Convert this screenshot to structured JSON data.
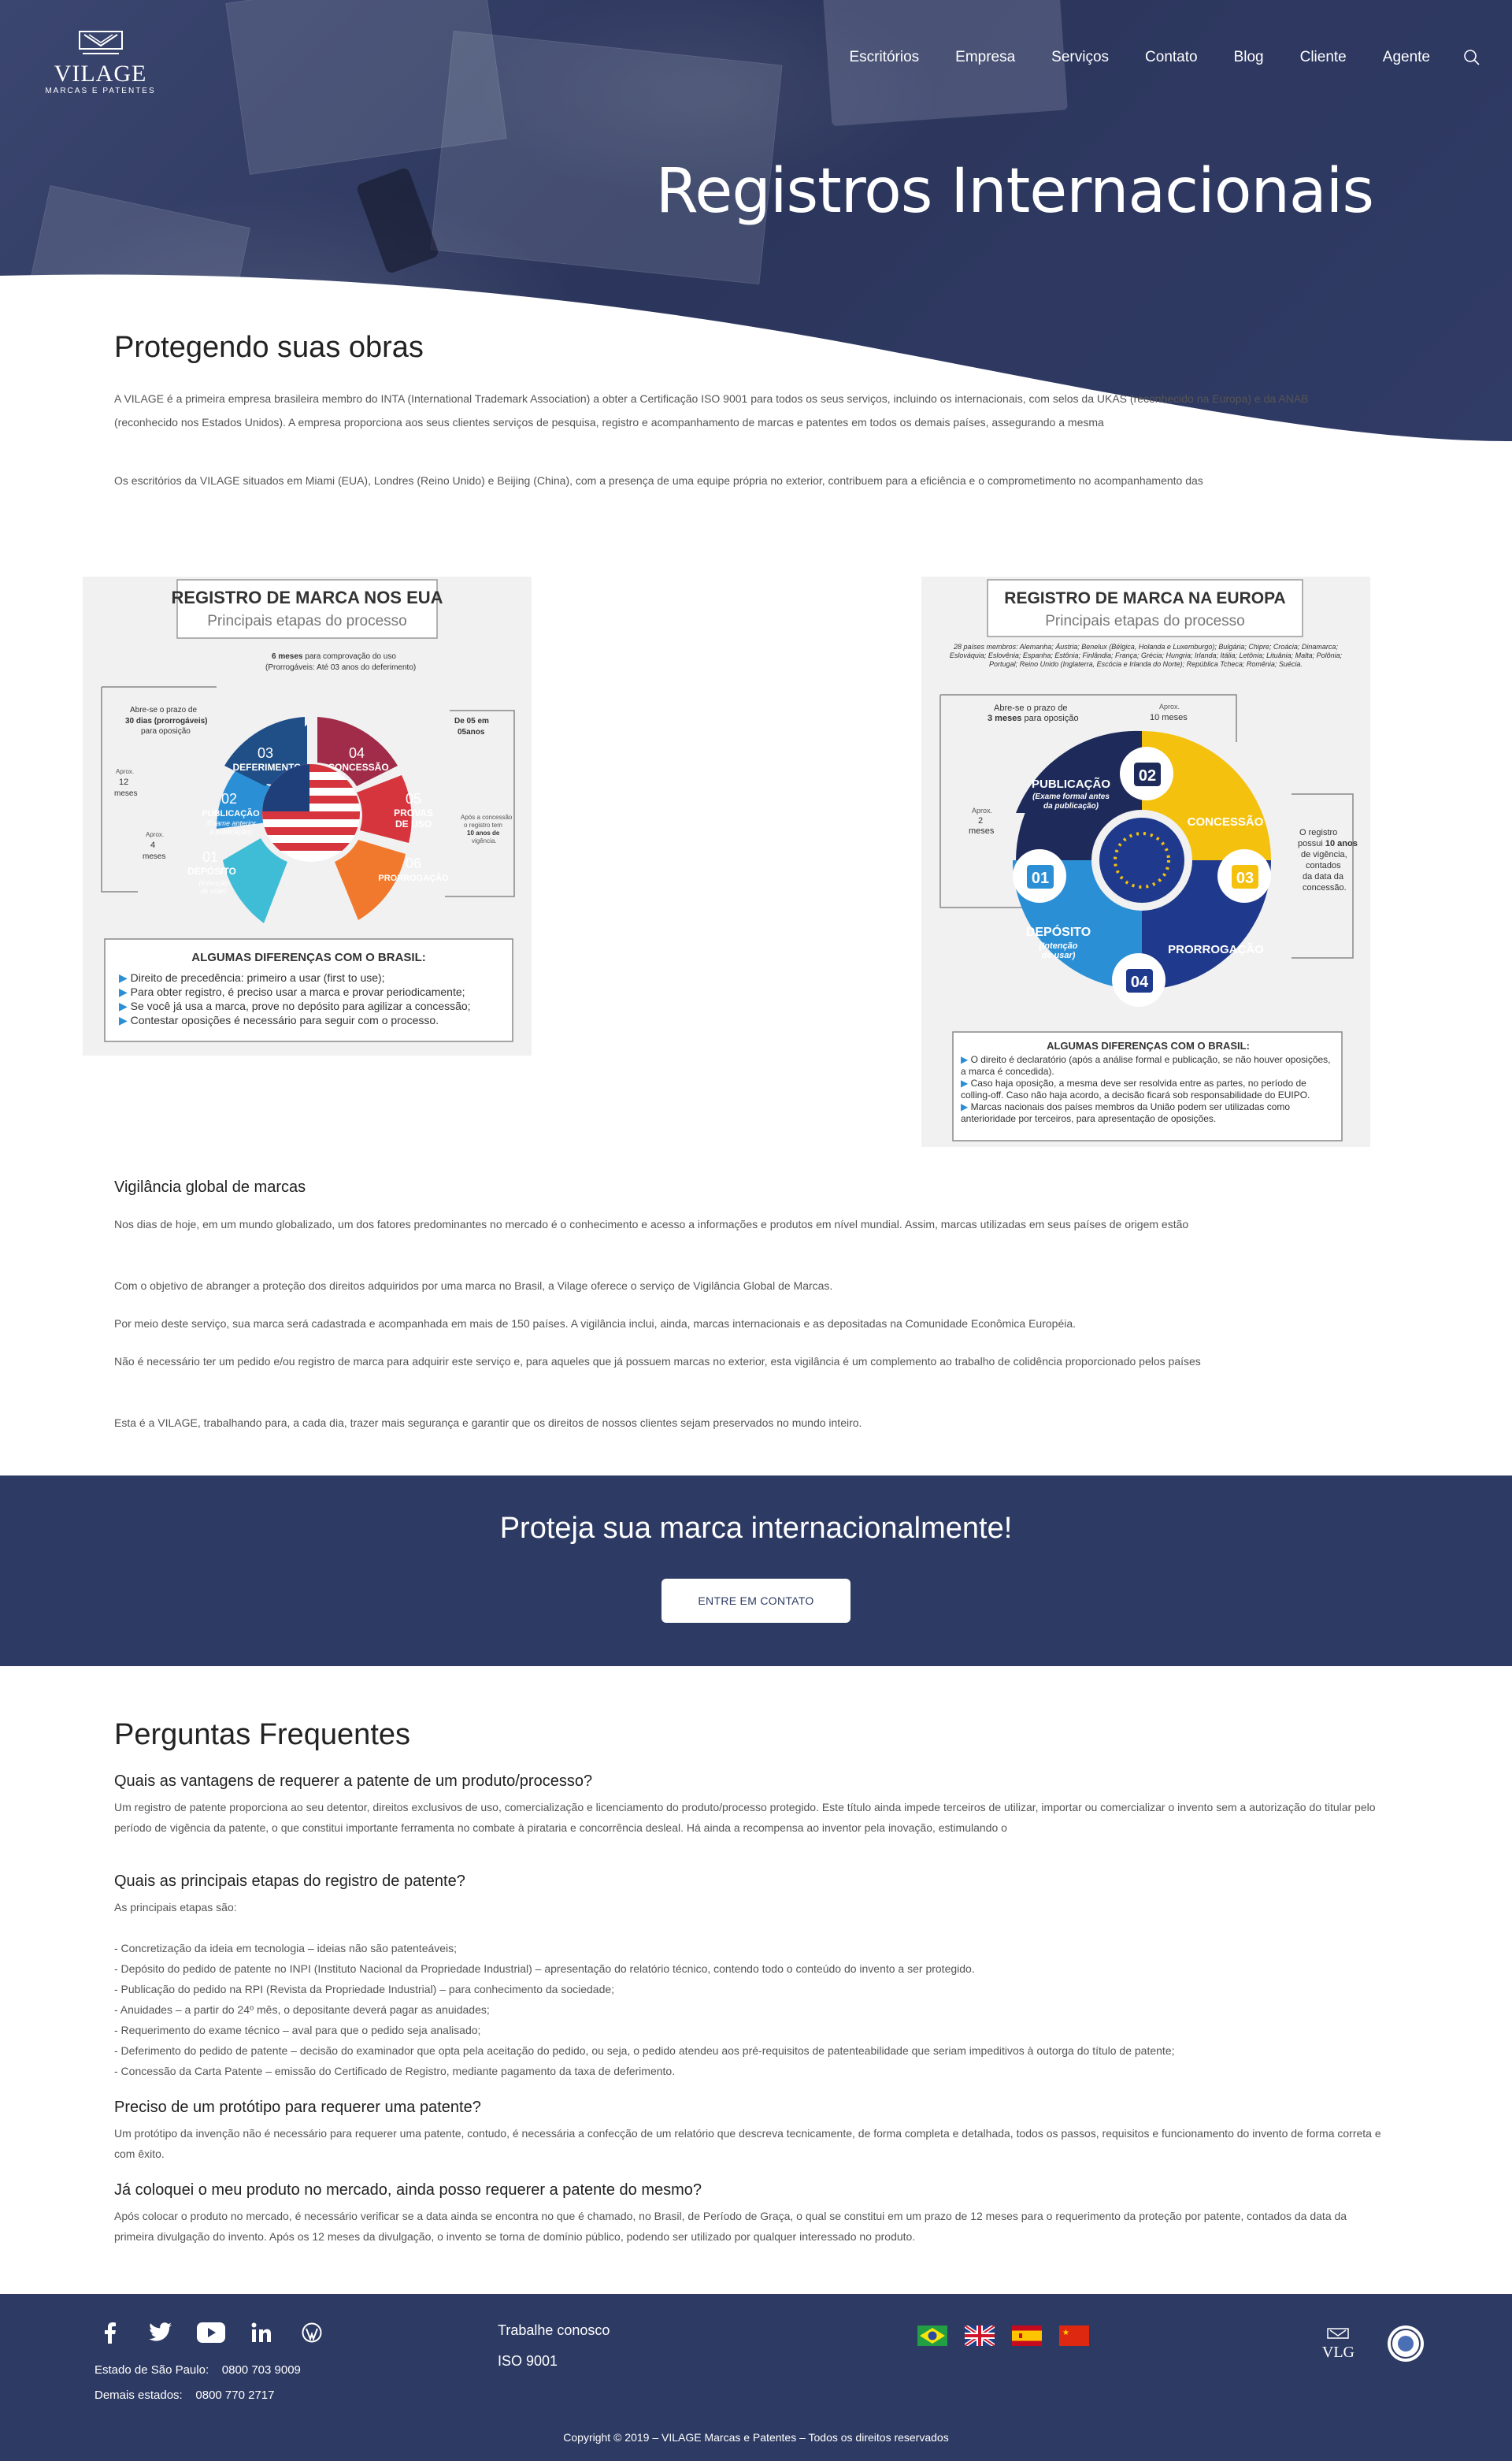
{
  "header": {
    "logo_name": "VILAGE",
    "logo_sub": "MARCAS E PATENTES",
    "nav": [
      "Escritórios",
      "Empresa",
      "Serviços",
      "Contato",
      "Blog",
      "Cliente",
      "Agente"
    ]
  },
  "hero": {
    "title": "Registros Internacionais"
  },
  "intro": {
    "title": "Protegendo suas obras",
    "p1": "A VILAGE é a primeira empresa brasileira membro do INTA (International Trademark Association) a obter a Certificação ISO 9001 para todos os seus serviços, incluindo os internacionais, com selos da UKAS (reconhecido na Europa) e da ANAB (reconhecido nos Estados Unidos). A empresa proporciona aos seus clientes serviços de pesquisa, registro e acompanhamento de marcas e patentes em todos os demais países, assegurando a mesma",
    "p2": "Os escritórios da VILAGE situados em Miami (EUA), Londres (Reino Unido) e Beijing (China), com a presença de uma equipe própria no exterior, contribuem para a eficiência e o comprometimento no acompanhamento das"
  },
  "infographic_eua": {
    "title": "REGISTRO DE MARCA NOS EUA",
    "subtitle": "Principais etapas do processo",
    "steps": [
      {
        "num": "01",
        "label": "DEPÓSITO",
        "sub": "(Intenção de usar)"
      },
      {
        "num": "02",
        "label": "PUBLICAÇÃO",
        "sub": "(Exame anterior à publicação)"
      },
      {
        "num": "03",
        "label": "DEFERIMENTO",
        "sub": ""
      },
      {
        "num": "04",
        "label": "CONCESSÃO",
        "sub": ""
      },
      {
        "num": "05",
        "label": "PROVAS DE USO",
        "sub": ""
      },
      {
        "num": "06",
        "label": "PRORROGAÇÃO",
        "sub": ""
      }
    ],
    "notes": {
      "top": "6 meses para comprovação do uso (Prorrogáveis: Até 03 anos do deferimento)",
      "left_top": "Abre-se o prazo de 30 dias (prorrogáveis) para oposição",
      "left_mid": "Aprox. 12 meses",
      "left_low": "Aprox. 4 meses",
      "right_top": "De 05 em 05anos",
      "right_low": "Após a concessão o registro tem 10 anos de vigência"
    },
    "diff_title": "ALGUMAS DIFERENÇAS COM O BRASIL:",
    "diffs": [
      "Direito de precedência: primeiro a usar (first to use);",
      "Para obter registro, é preciso usar a marca e provar periodicamente;",
      "Se você já usa a marca, prove no depósito para agilizar a concessão;",
      "Contestar oposições é necessário para seguir com o processo."
    ]
  },
  "infographic_eu": {
    "title": "REGISTRO DE MARCA NA EUROPA",
    "subtitle": "Principais etapas do processo",
    "members": "28 países membros: Alemanha; Áustria; Benelux (Bélgica, Holanda e Luxemburgo); Bulgária; Chipre; Croácia; Dinamarca; Eslováquia; Eslovênia; Espanha; Estônia; Finlândia; França; Grécia; Hungria; Irlanda; Itália; Letônia; Lituânia; Malta; Polônia; Portugal; Reino Unido (Inglaterra, Escócia e Irlanda do Norte); República Tcheca; Romênia; Suécia.",
    "steps": [
      {
        "num": "01",
        "label": "DEPÓSITO",
        "sub": "(Intenção de usar)"
      },
      {
        "num": "02",
        "label": "PUBLICAÇÃO",
        "sub": "(Exame formal antes da publicação)"
      },
      {
        "num": "03",
        "label": "CONCESSÃO",
        "sub": ""
      },
      {
        "num": "04",
        "label": "PRORROGAÇÃO",
        "sub": ""
      }
    ],
    "notes": {
      "top_left": "Abre-se o prazo de 3 meses para oposição",
      "top_right": "Aprox. 10 meses",
      "left": "Aprox. 2 meses",
      "right": "O registro possui 10 anos de vigência, contados da data da concessão."
    },
    "diff_title": "ALGUMAS DIFERENÇAS COM O BRASIL:",
    "diffs": [
      "O direito é declaratório (após a análise formal e publicação, se não houver oposições, a marca é concedida).",
      "Caso haja oposição, a mesma deve ser resolvida entre as partes, no período de colling-off. Caso não haja acordo, a decisão ficará sob responsabilidade do EUIPO.",
      "Marcas nacionais dos países membros da União podem ser utilizadas como anterioridade por terceiros, para apresentação de oposições."
    ]
  },
  "vigilancia": {
    "title": "Vigilância global de marcas",
    "p1": "Nos dias de hoje, em um mundo globalizado, um dos fatores predominantes no mercado é o conhecimento e acesso a informações e produtos em nível mundial. Assim, marcas utilizadas em seus países de origem estão",
    "p2": "Com o objetivo de abranger a proteção dos direitos adquiridos por uma marca no Brasil, a Vilage oferece o serviço de Vigilância Global de Marcas.",
    "p3": "Por meio deste serviço, sua marca será cadastrada e acompanhada em mais de 150 países. A vigilância inclui, ainda, marcas internacionais e as depositadas na Comunidade Econômica Européia.",
    "p4": "Não é necessário ter um pedido e/ou registro de marca para adquirir este serviço e, para aqueles que já possuem marcas no exterior, esta vigilância é um complemento ao trabalho de colidência proporcionado pelos países",
    "p5": "Esta é a VILAGE, trabalhando para, a cada dia, trazer mais segurança e garantir que os direitos de nossos clientes sejam preservados no mundo inteiro."
  },
  "cta": {
    "title": "Proteja sua marca internacionalmente!",
    "button": "ENTRE EM CONTATO"
  },
  "faq": {
    "title": "Perguntas Frequentes",
    "items": [
      {
        "q": "Quais as vantagens de requerer a patente de um produto/processo?",
        "a": "Um registro de patente proporciona ao seu detentor, direitos exclusivos de uso, comercialização e licenciamento do produto/processo protegido. Este título ainda impede terceiros de utilizar, importar ou comercializar o invento sem a autorização do titular pelo período de vigência da patente, o que constitui importante ferramenta no combate à pirataria e concorrência desleal. Há ainda a recompensa ao inventor pela inovação, estimulando o"
      },
      {
        "q": "Quais as principais etapas do registro de patente?",
        "a": "As principais etapas são:\n\n- Concretização da ideia em tecnologia – ideias não são patenteáveis;\n- Depósito do pedido de patente no INPI (Instituto Nacional da Propriedade Industrial) – apresentação do relatório técnico, contendo todo o conteúdo do invento a ser protegido.\n- Publicação do pedido na RPI (Revista da Propriedade Industrial) – para conhecimento da sociedade;\n- Anuidades – a partir do 24º mês, o depositante deverá pagar as anuidades;\n- Requerimento do exame técnico – aval para que o pedido seja analisado;\n- Deferimento do pedido de patente – decisão do examinador que opta pela aceitação do pedido, ou seja, o pedido atendeu aos pré-requisitos de patenteabilidade que seriam impeditivos à outorga do título de patente;\n- Concessão da Carta Patente – emissão do Certificado de Registro, mediante pagamento da taxa de deferimento."
      },
      {
        "q": "Preciso de um protótipo para requerer uma patente?",
        "a": "Um protótipo da invenção não é necessário para requerer uma patente, contudo, é necessária a confecção de um relatório que descreva tecnicamente, de forma completa e detalhada, todos os passos, requisitos e funcionamento do invento de forma correta e com êxito."
      },
      {
        "q": "Já coloquei o meu produto no mercado, ainda posso requerer a patente do mesmo?",
        "a": "Após colocar o produto no mercado, é necessário verificar se a data ainda se encontra no que é chamado, no Brasil, de Período de Graça, o qual se constitui em um prazo de 12 meses para o requerimento da proteção por patente, contados da data da primeira divulgação do invento. Após os 12 meses da divulgação, o invento se torna de domínio público, podendo ser utilizado por qualquer interessado no produto."
      }
    ]
  },
  "footer": {
    "social_icons": [
      "facebook-icon",
      "twitter-icon",
      "youtube-icon",
      "linkedin-icon",
      "wordpress-icon"
    ],
    "phone1_label": "Estado de São Paulo:",
    "phone1": "0800 703 9009",
    "phone2_label": "Demais estados:",
    "phone2": "0800 770 2717",
    "links": [
      "Trabalhe conosco",
      "ISO 9001"
    ],
    "flags": [
      "brazil-flag",
      "uk-flag",
      "spain-flag",
      "china-flag"
    ],
    "vlg": "VLG",
    "copyright": "Copyright © 2019 – VILAGE Marcas e Patentes – Todos os direitos reservados"
  }
}
